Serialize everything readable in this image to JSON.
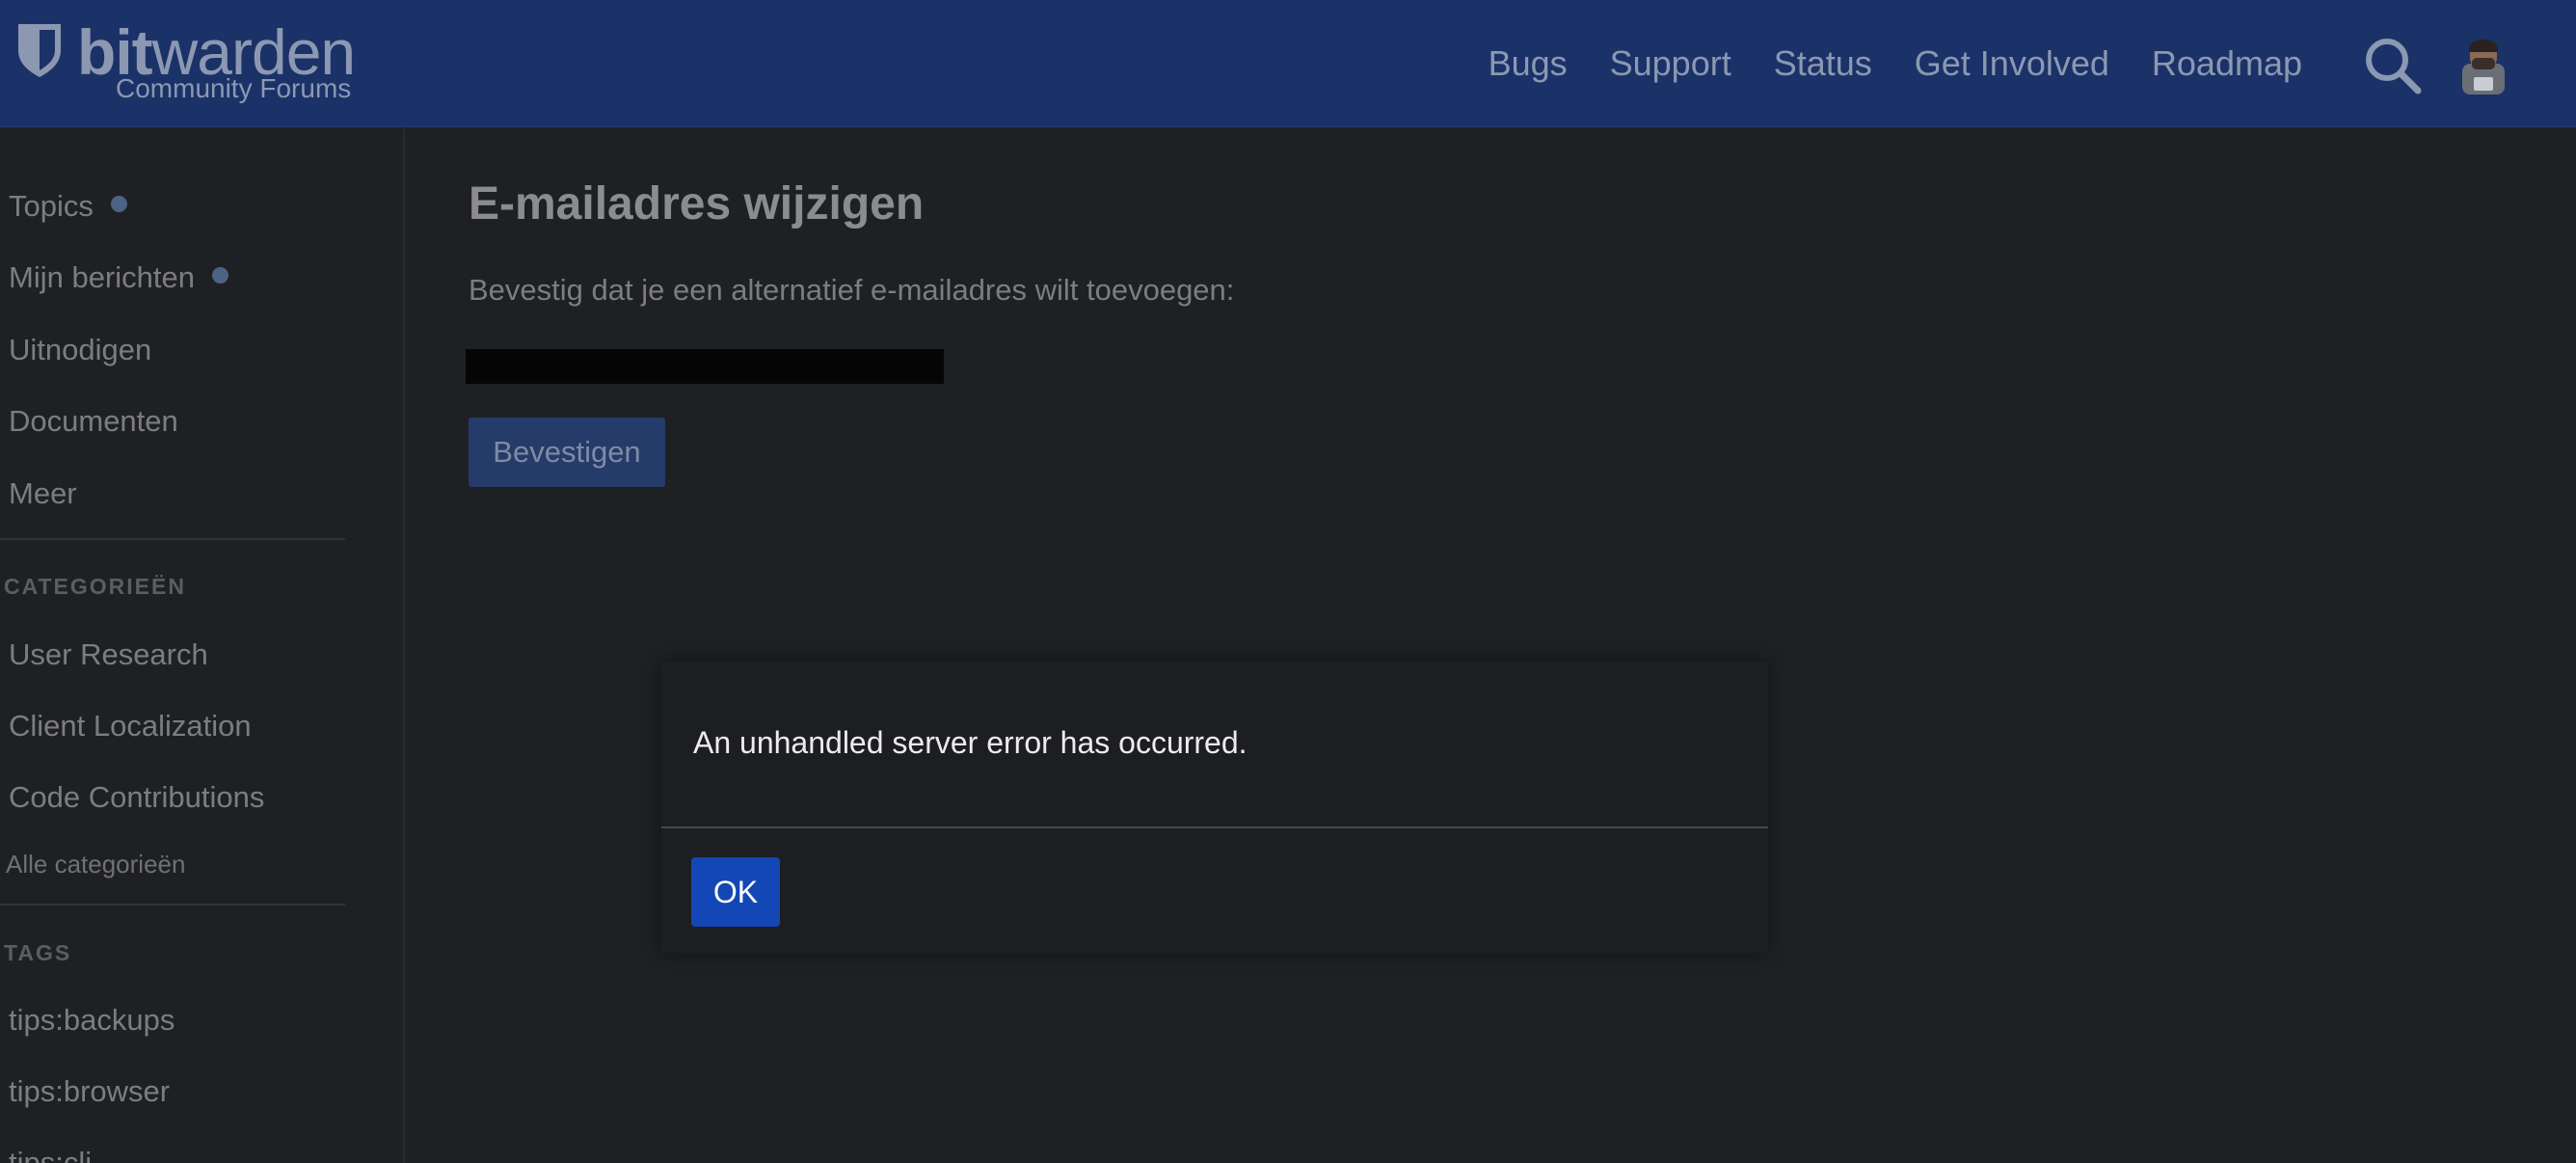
{
  "header": {
    "logo_bold": "bit",
    "logo_light": "warden",
    "logo_subtitle": "Community Forums",
    "nav": [
      {
        "label": "Bugs"
      },
      {
        "label": "Support"
      },
      {
        "label": "Status"
      },
      {
        "label": "Get Involved"
      },
      {
        "label": "Roadmap"
      }
    ],
    "icons": {
      "search": "search-icon",
      "avatar": "user-avatar"
    }
  },
  "sidebar": {
    "main_links": [
      {
        "label": "Topics",
        "unread_dot": true
      },
      {
        "label": "Mijn berichten",
        "unread_dot": true
      },
      {
        "label": "Uitnodigen"
      },
      {
        "label": "Documenten"
      },
      {
        "label": "Meer"
      }
    ],
    "categories_heading": "CATEGORIEËN",
    "categories": [
      {
        "label": "User Research"
      },
      {
        "label": "Client Localization"
      },
      {
        "label": "Code Contributions"
      }
    ],
    "all_categories": "Alle categorieën",
    "tags_heading": "TAGS",
    "tags": [
      {
        "label": "tips:backups"
      },
      {
        "label": "tips:browser"
      },
      {
        "label": "tips:cli"
      }
    ]
  },
  "main": {
    "title": "E-mailadres wijzigen",
    "instruction": "Bevestig dat je een alternatief e-mailadres wilt toevoegen:",
    "confirm_label": "Bevestigen"
  },
  "modal": {
    "message": "An unhandled server error has occurred.",
    "ok_label": "OK"
  },
  "colors": {
    "header_bg": "#1b3268",
    "page_bg": "#1f2024",
    "primary_button": "#1447b6",
    "dimmed_button": "#253b69",
    "unread_dot": "#4d6383"
  }
}
